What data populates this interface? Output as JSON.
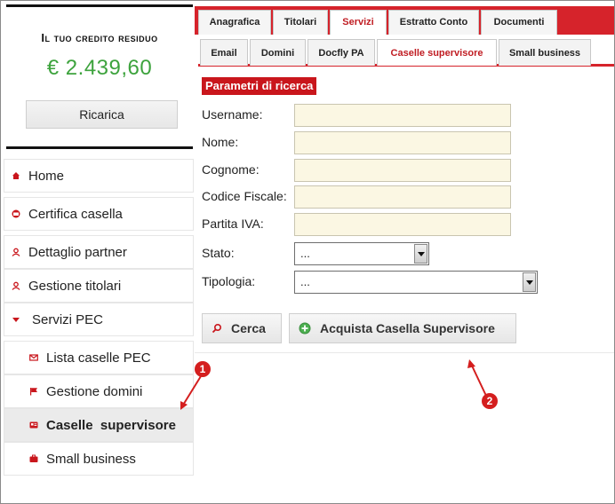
{
  "credit": {
    "title": "Il tuo credito residuo",
    "amount": "€ 2.439,60",
    "recharge_label": "Ricarica"
  },
  "sidebar": {
    "items": [
      {
        "label": "Home",
        "icon": "home-icon"
      },
      {
        "label": "Certifica casella",
        "icon": "mail-seal-icon"
      },
      {
        "label": "Dettaglio partner",
        "icon": "user-icon"
      },
      {
        "label": "Gestione titolari",
        "icon": "user-icon"
      },
      {
        "label": "Servizi PEC",
        "icon": "caret-down-icon"
      },
      {
        "label": "Lista caselle PEC",
        "icon": "envelope-icon"
      },
      {
        "label": "Gestione domini",
        "icon": "flag-icon"
      },
      {
        "label": "Caselle  supervisore",
        "icon": "id-card-icon"
      },
      {
        "label": "Small business",
        "icon": "briefcase-icon"
      }
    ]
  },
  "tabs_primary": [
    "Anagrafica",
    "Titolari",
    "Servizi",
    "Estratto Conto",
    "Documenti"
  ],
  "tabs_secondary": [
    "Email",
    "Domini",
    "Docfly PA",
    "Caselle supervisore",
    "Small business"
  ],
  "search": {
    "section_title": "Parametri di ricerca",
    "fields": {
      "username": "Username:",
      "nome": "Nome:",
      "cognome": "Cognome:",
      "codice_fiscale": "Codice Fiscale:",
      "partita_iva": "Partita IVA:",
      "stato": "Stato:",
      "tipologia": "Tipologia:"
    },
    "stato_value": "...",
    "tipologia_value": "...",
    "search_button": "Cerca",
    "buy_button": "Acquista Casella Supervisore"
  },
  "annotations": [
    "1",
    "2"
  ],
  "colors": {
    "accent": "#d6232b",
    "credit_green": "#3da33d",
    "input_bg": "#fbf7e3"
  }
}
